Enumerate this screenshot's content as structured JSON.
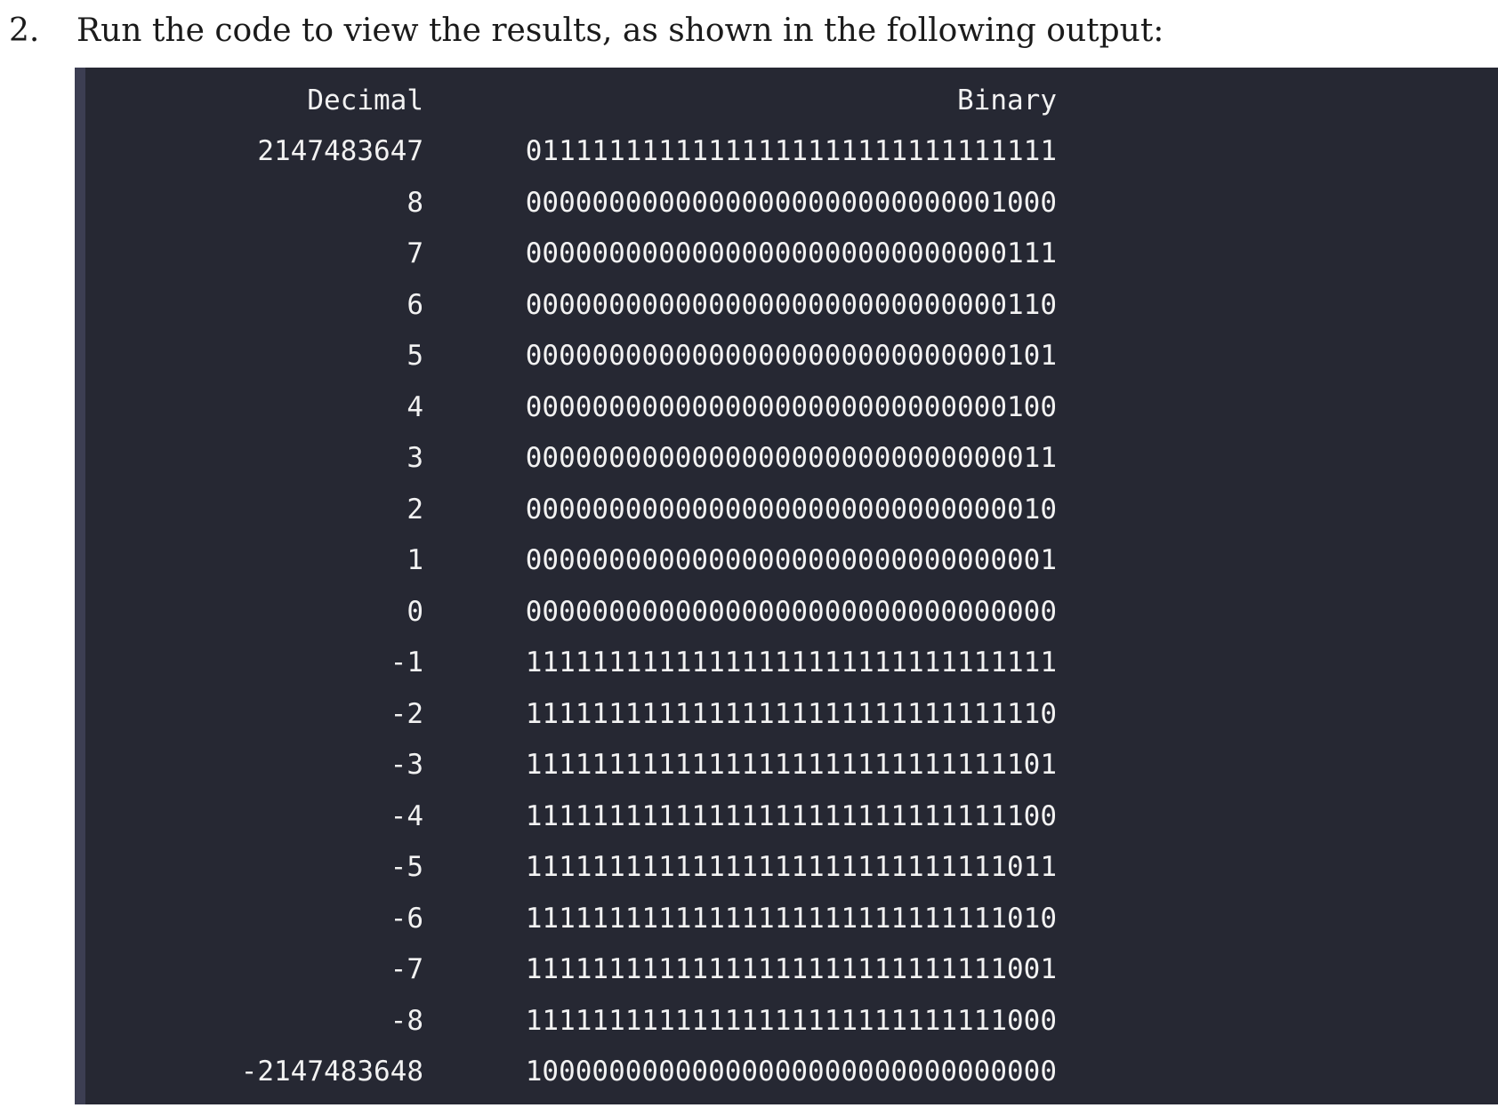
{
  "step": {
    "number": "2.",
    "text": "Run the code to view the results, as shown in the following output:"
  },
  "output": {
    "headers": {
      "decimal": "Decimal",
      "binary": "Binary"
    },
    "rows": [
      {
        "decimal": "2147483647",
        "binary": "01111111111111111111111111111111"
      },
      {
        "decimal": "8",
        "binary": "00000000000000000000000000001000"
      },
      {
        "decimal": "7",
        "binary": "00000000000000000000000000000111"
      },
      {
        "decimal": "6",
        "binary": "00000000000000000000000000000110"
      },
      {
        "decimal": "5",
        "binary": "00000000000000000000000000000101"
      },
      {
        "decimal": "4",
        "binary": "00000000000000000000000000000100"
      },
      {
        "decimal": "3",
        "binary": "00000000000000000000000000000011"
      },
      {
        "decimal": "2",
        "binary": "00000000000000000000000000000010"
      },
      {
        "decimal": "1",
        "binary": "00000000000000000000000000000001"
      },
      {
        "decimal": "0",
        "binary": "00000000000000000000000000000000"
      },
      {
        "decimal": "-1",
        "binary": "11111111111111111111111111111111"
      },
      {
        "decimal": "-2",
        "binary": "11111111111111111111111111111110"
      },
      {
        "decimal": "-3",
        "binary": "11111111111111111111111111111101"
      },
      {
        "decimal": "-4",
        "binary": "11111111111111111111111111111100"
      },
      {
        "decimal": "-5",
        "binary": "11111111111111111111111111111011"
      },
      {
        "decimal": "-6",
        "binary": "11111111111111111111111111111010"
      },
      {
        "decimal": "-7",
        "binary": "11111111111111111111111111111001"
      },
      {
        "decimal": "-8",
        "binary": "11111111111111111111111111111000"
      },
      {
        "decimal": "-2147483648",
        "binary": "10000000000000000000000000000000"
      }
    ]
  },
  "colors": {
    "code_background": "#262833",
    "code_border": "#3c3e52",
    "code_text": "#f2f2f2",
    "body_text": "#1b1b1b"
  }
}
